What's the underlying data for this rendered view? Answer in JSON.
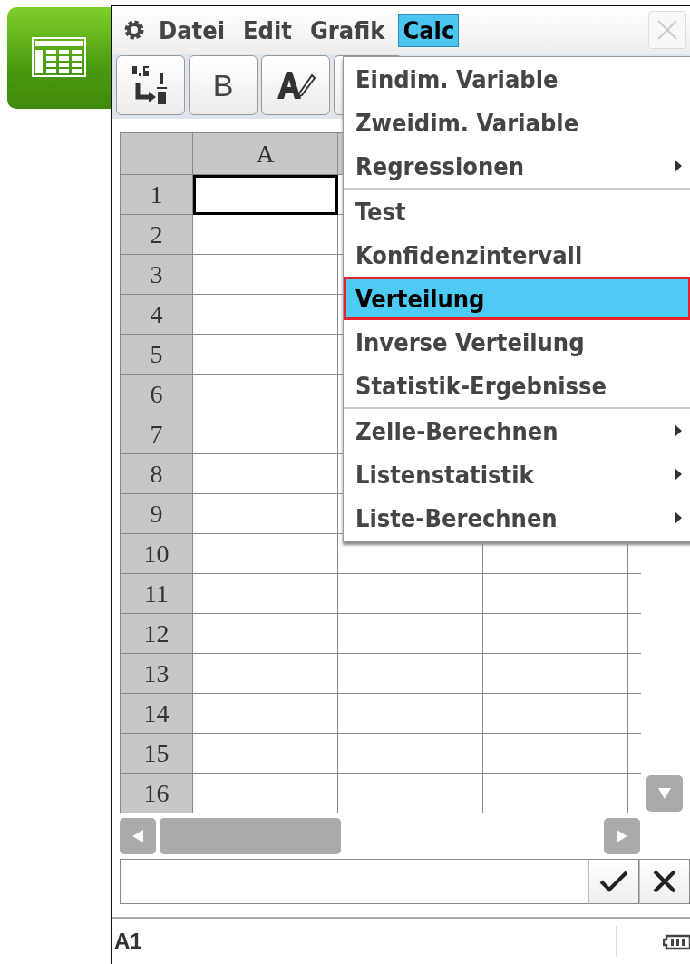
{
  "menubar": {
    "items": [
      {
        "label": "Datei",
        "selected": false
      },
      {
        "label": "Edit",
        "selected": false
      },
      {
        "label": "Grafik",
        "selected": false
      },
      {
        "label": "Calc",
        "selected": true
      }
    ]
  },
  "toolbar": {
    "buttons": [
      {
        "kind": "fraction-convert"
      },
      {
        "kind": "text",
        "label": "B"
      },
      {
        "kind": "text-style"
      },
      {
        "kind": "blank"
      }
    ]
  },
  "sheet": {
    "columns": [
      "A"
    ],
    "rows": [
      {
        "label": "1",
        "selected": true
      },
      {
        "label": "2",
        "selected": false
      },
      {
        "label": "3",
        "selected": false
      },
      {
        "label": "4",
        "selected": false
      },
      {
        "label": "5",
        "selected": false
      },
      {
        "label": "6",
        "selected": false
      },
      {
        "label": "7",
        "selected": false
      },
      {
        "label": "8",
        "selected": false
      },
      {
        "label": "9",
        "selected": false
      },
      {
        "label": "10",
        "selected": false
      },
      {
        "label": "11",
        "selected": false
      },
      {
        "label": "12",
        "selected": false
      },
      {
        "label": "13",
        "selected": false
      },
      {
        "label": "14",
        "selected": false
      },
      {
        "label": "15",
        "selected": false
      },
      {
        "label": "16",
        "selected": false
      }
    ]
  },
  "menu": {
    "groups": [
      [
        {
          "label": "Eindim. Variable",
          "selected": false,
          "has_submenu": false
        },
        {
          "label": "Zweidim. Variable",
          "selected": false,
          "has_submenu": false
        },
        {
          "label": "Regressionen",
          "selected": false,
          "has_submenu": true
        }
      ],
      [
        {
          "label": "Test",
          "selected": false,
          "has_submenu": false
        },
        {
          "label": "Konfidenzintervall",
          "selected": false,
          "has_submenu": false
        },
        {
          "label": "Verteilung",
          "selected": true,
          "has_submenu": false
        },
        {
          "label": "Inverse Verteilung",
          "selected": false,
          "has_submenu": false
        },
        {
          "label": "Statistik-Ergebnisse",
          "selected": false,
          "has_submenu": false
        }
      ],
      [
        {
          "label": "Zelle-Berechnen",
          "selected": false,
          "has_submenu": true
        },
        {
          "label": "Listenstatistik",
          "selected": false,
          "has_submenu": true
        },
        {
          "label": "Liste-Berechnen",
          "selected": false,
          "has_submenu": true
        }
      ]
    ]
  },
  "status_bar": {
    "cell": "A1"
  }
}
